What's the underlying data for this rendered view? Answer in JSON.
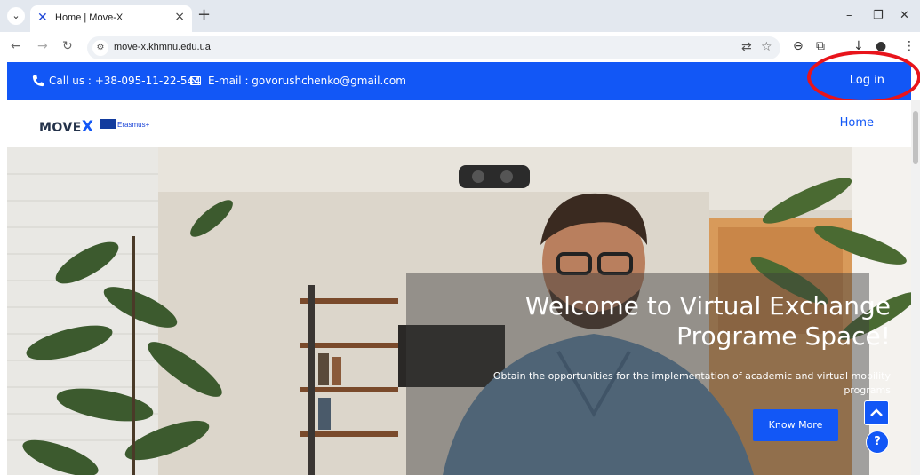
{
  "browser": {
    "tab_title": "Home | Move-X",
    "tab_close": "×",
    "new_tab": "+",
    "url": "move-x.khmnu.edu.ua",
    "icons": [
      "tab-search-icon",
      "back-icon",
      "forward-icon",
      "reload-icon",
      "site-info-icon",
      "translate-icon",
      "bookmark-star-icon",
      "extension-icon",
      "puzzle-icon",
      "download-icon",
      "profile-icon",
      "menu-icon"
    ],
    "window_controls": [
      "–",
      "❐",
      "✕"
    ]
  },
  "topbar": {
    "call": "Call us : +38-095-11-22-544",
    "email": "E-mail : govorushchenko@gmail.com",
    "login": "Log in",
    "bg_color": "#1257f6"
  },
  "header": {
    "logo": "MOVE",
    "logo_x": "X",
    "erasmus": "Erasmus+",
    "nav_home": "Home"
  },
  "hero": {
    "title": "Welcome to Virtual Exchange Programe Space!",
    "subtitle": "Obtain the opportunities for the implementation of academic and virtual mobility programs",
    "button": "Know More",
    "help": "?"
  },
  "annotation": {
    "circle_color": "#e8141b"
  }
}
